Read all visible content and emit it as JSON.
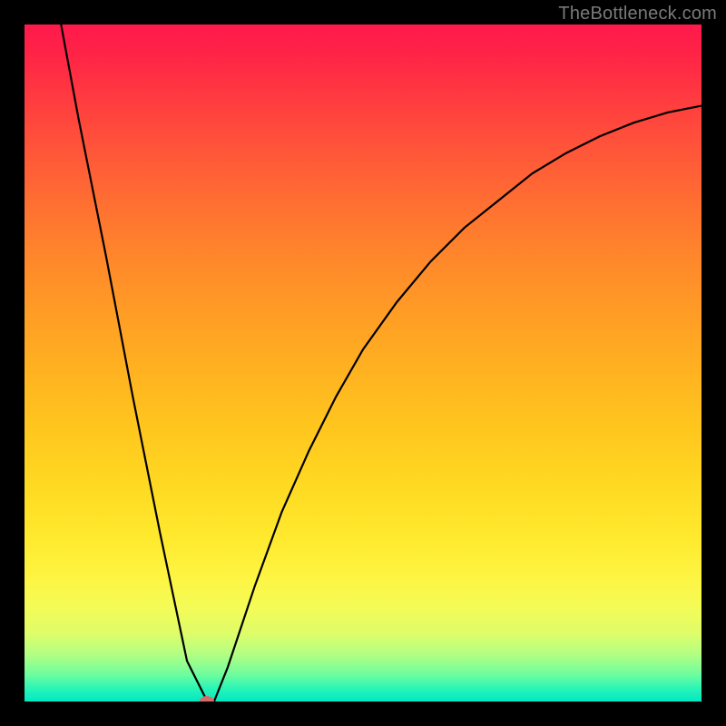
{
  "watermark": "TheBottleneck.com",
  "colors": {
    "frame": "#000000",
    "curve": "#000000",
    "marker": "#d96a6a"
  },
  "chart_data": {
    "type": "line",
    "title": "",
    "xlabel": "",
    "ylabel": "",
    "xlim": [
      0,
      100
    ],
    "ylim": [
      0,
      100
    ],
    "grid": false,
    "legend": false,
    "series": [
      {
        "name": "bottleneck-curve",
        "x": [
          5.4,
          8,
          12,
          16,
          20,
          24,
          27,
          28,
          30,
          34,
          38,
          42,
          46,
          50,
          55,
          60,
          65,
          70,
          75,
          80,
          85,
          90,
          95,
          100
        ],
        "y": [
          100,
          86,
          66,
          45,
          25,
          6,
          0,
          0,
          5,
          17,
          28,
          37,
          45,
          52,
          59,
          65,
          70,
          74,
          78,
          81,
          83.5,
          85.5,
          87,
          88
        ]
      }
    ],
    "marker": {
      "x": 27,
      "y": 0
    },
    "background_gradient": {
      "type": "vertical",
      "stops": [
        {
          "pos": 0,
          "color": "#ff1a4d"
        },
        {
          "pos": 50,
          "color": "#ffb420"
        },
        {
          "pos": 82,
          "color": "#fdf544"
        },
        {
          "pos": 100,
          "color": "#00e8c3"
        }
      ]
    }
  }
}
